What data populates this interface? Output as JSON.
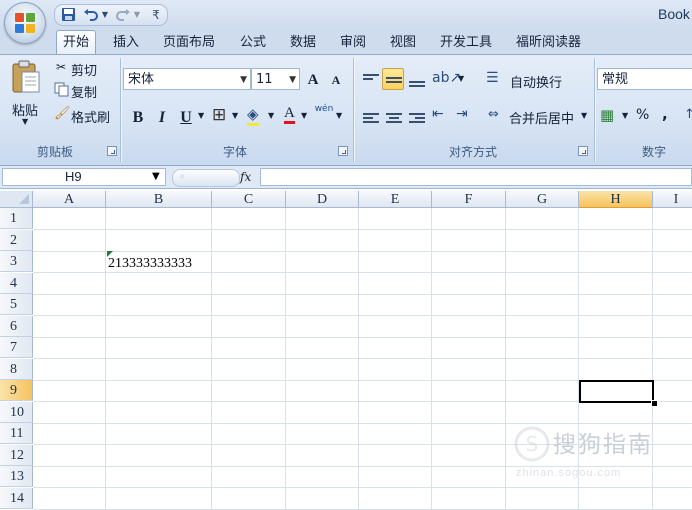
{
  "window": {
    "title": "Book"
  },
  "qat": {
    "save": "save-icon",
    "undo": "undo-icon",
    "redo": "redo-icon",
    "customize": "₹"
  },
  "tabs": [
    "开始",
    "插入",
    "页面布局",
    "公式",
    "数据",
    "审阅",
    "视图",
    "开发工具",
    "福昕阅读器"
  ],
  "ribbon": {
    "clipboard": {
      "paste": "粘贴",
      "cut": "剪切",
      "copy": "复制",
      "format_painter": "格式刷",
      "label": "剪贴板"
    },
    "font": {
      "font_name": "宋体",
      "font_size": "11",
      "bold": "B",
      "italic": "I",
      "underline": "U",
      "label": "字体",
      "grow": "A",
      "shrink": "A",
      "phonetic": "wén"
    },
    "alignment": {
      "wrap": "自动换行",
      "merge": "合并后居中",
      "label": "对齐方式"
    },
    "number": {
      "format": "常规",
      "percent": "%",
      "comma": ",",
      "label": "数字"
    }
  },
  "formula_bar": {
    "name_box": "H9",
    "fx": "fx",
    "formula": ""
  },
  "sheet": {
    "columns": [
      "A",
      "B",
      "C",
      "D",
      "E",
      "F",
      "G",
      "H",
      "I"
    ],
    "rows": [
      "1",
      "2",
      "3",
      "4",
      "5",
      "6",
      "7",
      "8",
      "9",
      "10",
      "11",
      "12",
      "13",
      "14"
    ],
    "selected_column": "H",
    "selected_row": "9",
    "cells": {
      "B3": "213333333333"
    }
  },
  "watermark": {
    "text": "搜狗指南",
    "sub": "zhinan.sogou.com"
  },
  "colors": {
    "accent": "#f5c35e",
    "ribbon": "#d7e4f4",
    "grid": "#d9e0ea",
    "error_triangle": "#1e7b34"
  }
}
